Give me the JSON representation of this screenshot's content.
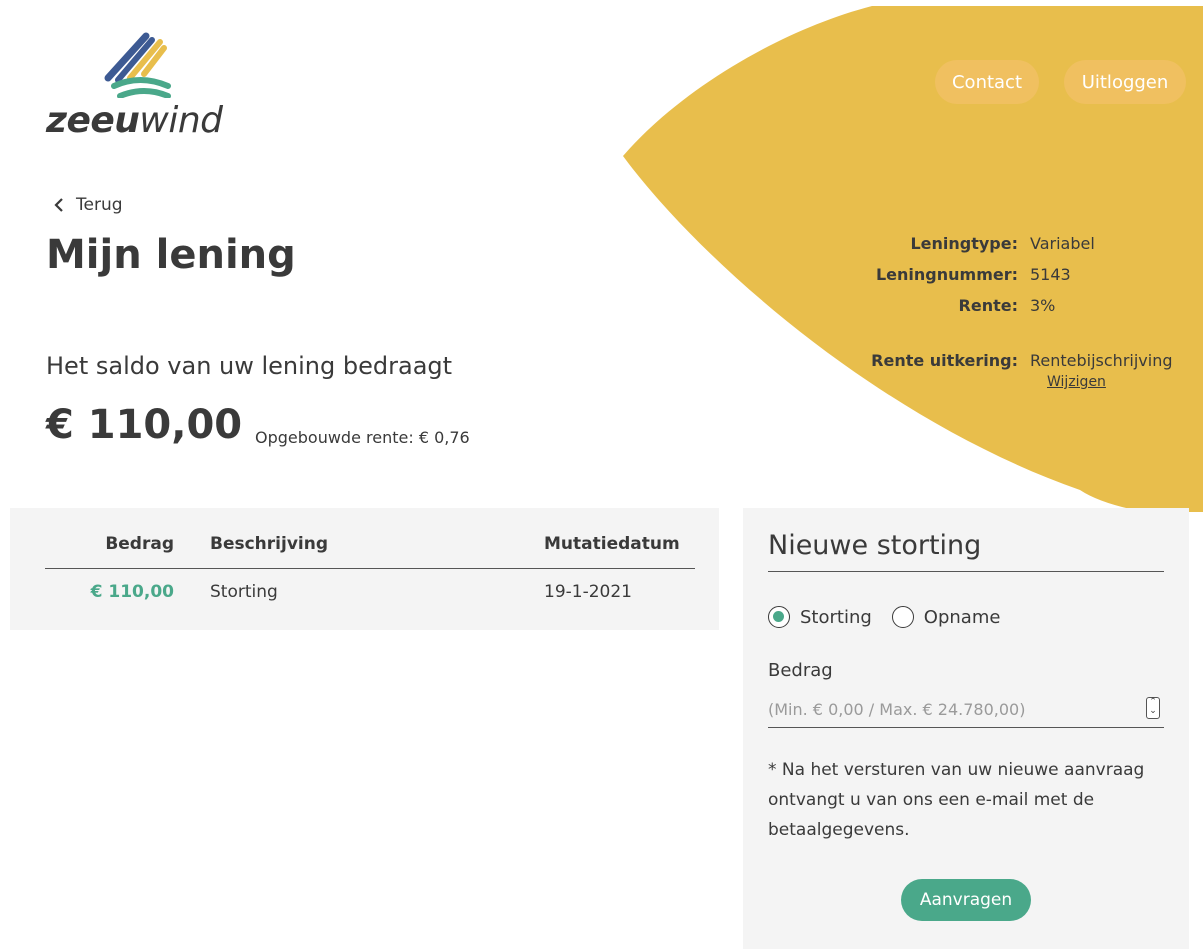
{
  "brand": {
    "logo_bold": "zeeu",
    "logo_light": "wind"
  },
  "header": {
    "contact_label": "Contact",
    "logout_label": "Uitloggen"
  },
  "page": {
    "back_label": "Terug",
    "title": "Mijn lening",
    "saldo_label": "Het saldo van uw lening bedraagt",
    "saldo_amount": "€ 110,00",
    "accrued_interest": "Opgebouwde rente: € 0,76"
  },
  "loan_info": {
    "type_label": "Leningtype:",
    "type_value": "Variabel",
    "number_label": "Leningnummer:",
    "number_value": "5143",
    "rate_label": "Rente:",
    "rate_value": "3%",
    "payout_label": "Rente uitkering:",
    "payout_value": "Rentebijschrijving",
    "change_link": "Wijzigen"
  },
  "transactions": {
    "headers": {
      "amount": "Bedrag",
      "description": "Beschrijving",
      "date": "Mutatiedatum"
    },
    "rows": [
      {
        "amount": "€ 110,00",
        "description": "Storting",
        "date": "19-1-2021"
      }
    ]
  },
  "form": {
    "title": "Nieuwe storting",
    "radio_deposit": "Storting",
    "radio_withdraw": "Opname",
    "selected": "Storting",
    "amount_label": "Bedrag",
    "amount_placeholder": "(Min. € 0,00 / Max. € 24.780,00)",
    "note": "* Na het versturen van uw nieuwe aanvraag ontvangt u van ons een e-mail met de betaalgegevens.",
    "submit_label": "Aanvragen"
  },
  "colors": {
    "accent_yellow": "#e8be4c",
    "accent_green": "#4aa88a",
    "logo_blue": "#3d5a93",
    "logo_teal": "#4aa88a"
  }
}
